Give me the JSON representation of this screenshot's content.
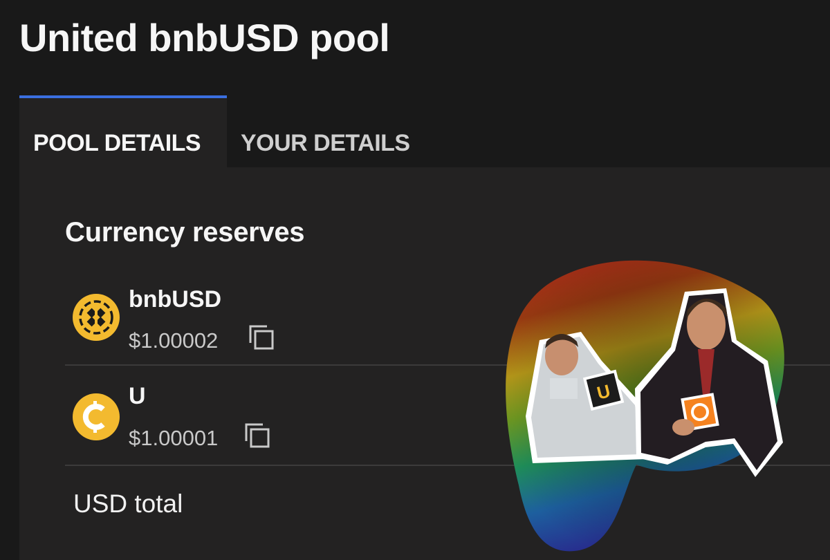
{
  "header": {
    "title": "United bnbUSD pool"
  },
  "tabs": [
    {
      "label": "POOL DETAILS",
      "active": true
    },
    {
      "label": "YOUR DETAILS",
      "active": false
    }
  ],
  "reserves": {
    "section_title": "Currency reserves",
    "items": [
      {
        "name": "bnbUSD",
        "price": "$1.00002",
        "icon": "bnbusd-coin-icon",
        "color": "#f3ba2f"
      },
      {
        "name": "U",
        "price": "$1.00001",
        "icon": "u-coin-icon",
        "color": "#f3ba2f"
      }
    ],
    "total_label": "USD total"
  },
  "stickers": {
    "left_card_letter": "U"
  },
  "colors": {
    "accent": "#3a6fe0",
    "background": "#191919",
    "panel": "#232222",
    "coin": "#f3ba2f",
    "sticker_card_orange": "#f5821f"
  }
}
